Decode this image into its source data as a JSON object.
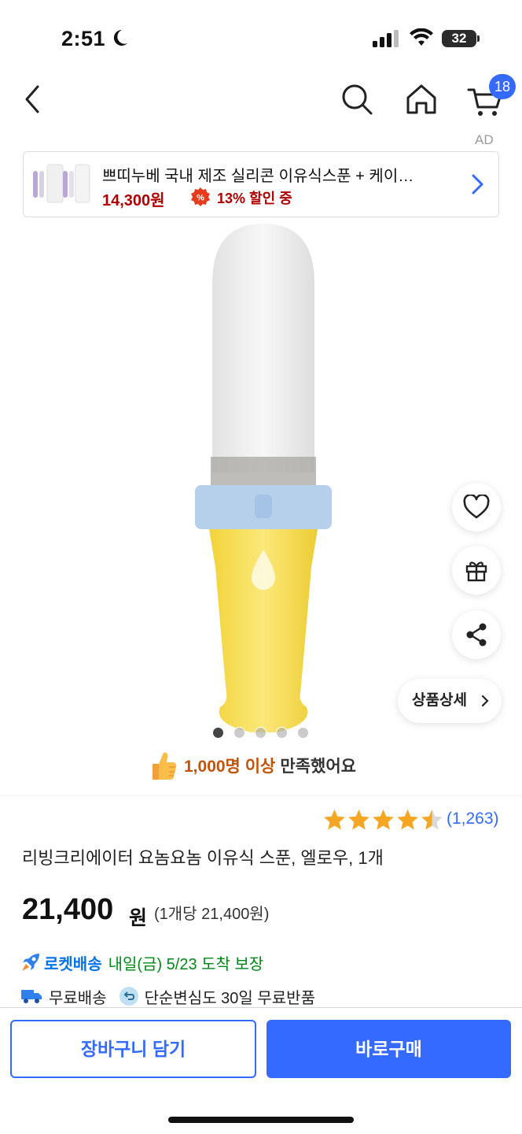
{
  "status_bar": {
    "time": "2:51",
    "battery": "32"
  },
  "nav": {
    "cart_count": "18"
  },
  "ad": {
    "label": "AD",
    "title": "쁘띠누베 국내 제조 실리콘 이유식스푼 + 케이…",
    "price": "14,300원",
    "discount": "13% 할인 중"
  },
  "gallery": {
    "image_count": 5,
    "active_index": 0
  },
  "side_actions": {
    "detail_label": "상품상세"
  },
  "satisfaction": {
    "highlight": "1,000명 이상",
    "rest": "만족했어요"
  },
  "rating": {
    "stars": 4.5,
    "count": "(1,263)"
  },
  "product": {
    "title": "리빙크리에이터 요놈요놈 이유식 스푼, 엘로우, 1개",
    "price": "21,400",
    "currency": "원",
    "unit_price": "(1개당 21,400원)"
  },
  "delivery": {
    "rocket_label": "로켓배송",
    "arrival": "내일(금) 5/23 도착 보장",
    "free_shipping": "무료배송",
    "return_policy": "단순변심도 30일 무료반품"
  },
  "actions": {
    "add_to_cart": "장바구니 담기",
    "buy_now": "바로구매"
  },
  "colors": {
    "accent": "#346aff",
    "price_red": "#ae0000",
    "star": "#f5a623",
    "arrival_green": "#00891a"
  }
}
